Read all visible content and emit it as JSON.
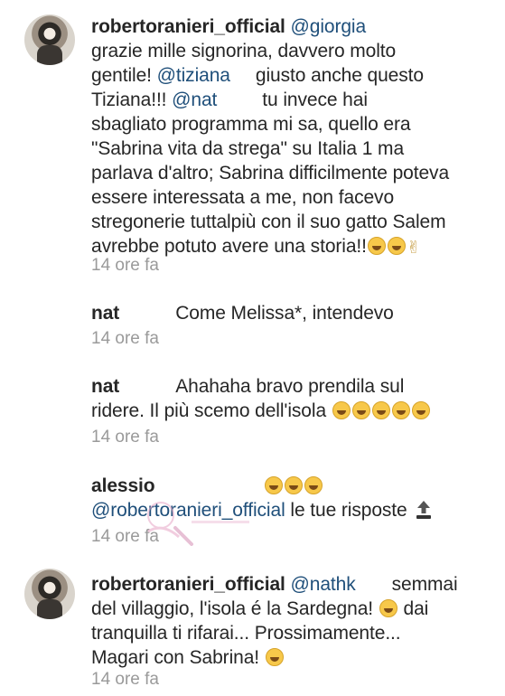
{
  "comments": [
    {
      "lines": [
        [
          {
            "t": "user",
            "v": "robertoranieri_official"
          },
          {
            "t": "sp"
          },
          {
            "t": "mention",
            "v": "@giorgia"
          }
        ],
        [
          {
            "t": "text",
            "v": "grazie mille signorina, davvero molto"
          }
        ],
        [
          {
            "t": "text",
            "v": "gentile! "
          },
          {
            "t": "mention",
            "v": "@tiziana"
          },
          {
            "t": "gap",
            "w": 28
          },
          {
            "t": "text",
            "v": "giusto anche questo"
          }
        ],
        [
          {
            "t": "text",
            "v": "Tiziana!!! "
          },
          {
            "t": "mention",
            "v": "@nat"
          },
          {
            "t": "gap",
            "w": 50
          },
          {
            "t": "text",
            "v": "tu invece hai"
          }
        ],
        [
          {
            "t": "text",
            "v": "sbagliato programma mi sa, quello era"
          }
        ],
        [
          {
            "t": "text",
            "v": "\"Sabrina vita da strega\" su Italia 1 ma"
          }
        ],
        [
          {
            "t": "text",
            "v": "parlava d'altro; Sabrina difficilmente poteva"
          }
        ],
        [
          {
            "t": "text",
            "v": "essere interessata a me, non facevo"
          }
        ],
        [
          {
            "t": "text",
            "v": "stregonerie tuttalpiù con il suo gatto Salem"
          }
        ],
        [
          {
            "t": "text",
            "v": "avrebbe potuto avere una storia!!"
          },
          {
            "t": "emoji"
          },
          {
            "t": "emoji"
          },
          {
            "t": "victory"
          }
        ]
      ],
      "time": "14 ore fa"
    },
    {
      "lines": [
        [
          {
            "t": "user",
            "v": "nat"
          },
          {
            "t": "gap",
            "w": 62
          },
          {
            "t": "text",
            "v": "Come Melissa*, intendevo"
          }
        ]
      ],
      "time": "14 ore fa"
    },
    {
      "lines": [
        [
          {
            "t": "user",
            "v": "nat"
          },
          {
            "t": "gap",
            "w": 62
          },
          {
            "t": "text",
            "v": "Ahahaha bravo prendila sul"
          }
        ],
        [
          {
            "t": "text",
            "v": "ridere. Il più scemo dell'isola "
          },
          {
            "t": "emoji"
          },
          {
            "t": "emoji"
          },
          {
            "t": "emoji"
          },
          {
            "t": "emoji"
          },
          {
            "t": "emoji"
          }
        ]
      ],
      "time": "14 ore fa"
    },
    {
      "lines": [
        [
          {
            "t": "user",
            "v": "alessio"
          },
          {
            "t": "gap",
            "w": 120
          },
          {
            "t": "emoji"
          },
          {
            "t": "emoji"
          },
          {
            "t": "emoji"
          }
        ],
        [
          {
            "t": "mention",
            "v": "@robertoranieri_official"
          },
          {
            "t": "text",
            "v": " le tue risposte "
          },
          {
            "t": "top"
          }
        ]
      ],
      "time": "14 ore fa"
    },
    {
      "lines": [
        [
          {
            "t": "user",
            "v": "robertoranieri_official"
          },
          {
            "t": "sp"
          },
          {
            "t": "mention",
            "v": "@nathk"
          },
          {
            "t": "gap",
            "w": 40
          },
          {
            "t": "text",
            "v": "semmai"
          }
        ],
        [
          {
            "t": "text",
            "v": "del villaggio, l'isola é la Sardegna! "
          },
          {
            "t": "emoji"
          },
          {
            "t": "text",
            "v": " dai"
          }
        ],
        [
          {
            "t": "text",
            "v": "tranquilla ti rifarai... Prossimamente..."
          }
        ],
        [
          {
            "t": "text",
            "v": "Magari con Sabrina! "
          },
          {
            "t": "emoji"
          }
        ]
      ],
      "time": "14 ore fa"
    }
  ],
  "colors": {
    "username": "#262626",
    "mention": "#1f4f7a",
    "timestamp": "#9a9a9a",
    "emoji": "#f7c84a"
  },
  "icons": {
    "top": "top-arrow-icon",
    "victory": "victory-hand-icon",
    "emoji": "laughing-face-icon"
  }
}
